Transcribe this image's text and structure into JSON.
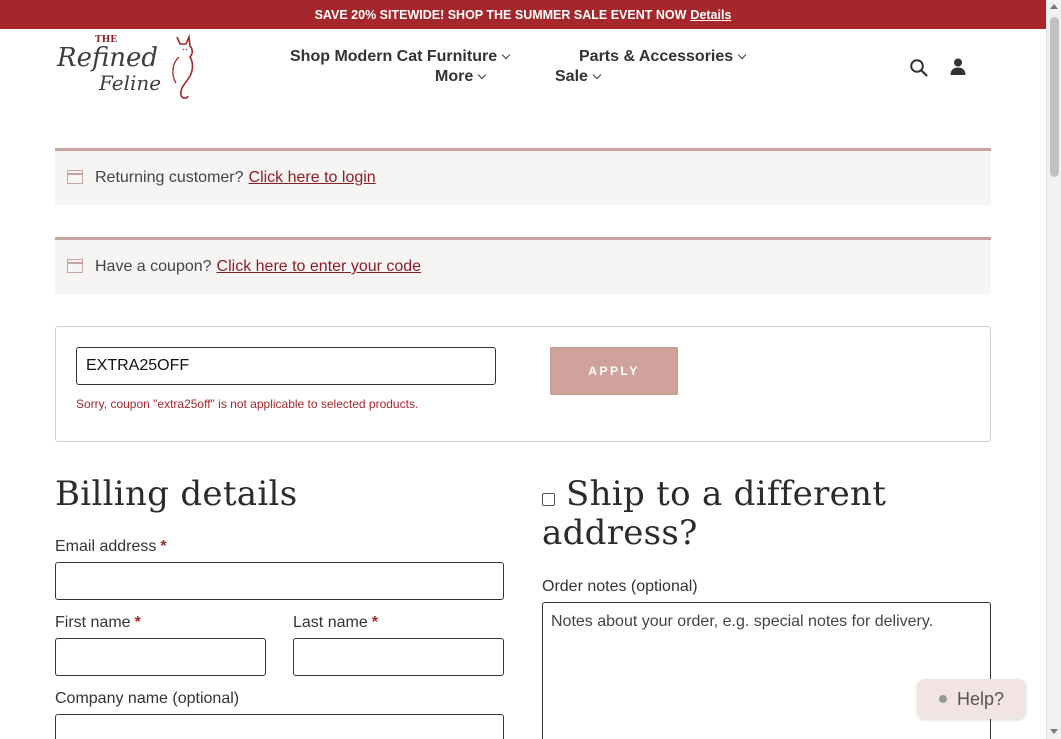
{
  "promo": {
    "text": "SAVE 20% SITEWIDE! SHOP THE SUMMER SALE EVENT NOW",
    "link_label": "Details"
  },
  "logo": {
    "small": "THE",
    "line1": "Refined",
    "line2": "Feline",
    "icon": "cat-silhouette-logo"
  },
  "nav": {
    "items": [
      {
        "label": "Shop Modern Cat Furniture"
      },
      {
        "label": "Parts & Accessories"
      },
      {
        "label": "More"
      },
      {
        "label": "Sale"
      }
    ],
    "icons": [
      "search-icon",
      "account-icon",
      "chevron-down-icon"
    ]
  },
  "notices": {
    "login": {
      "text": "Returning customer?",
      "link_label": "Click here to login"
    },
    "coupon": {
      "text": "Have a coupon?",
      "link_label": "Click here to enter your code"
    }
  },
  "coupon_form": {
    "value": "EXTRA25OFF",
    "error": "Sorry, coupon \"extra25off\" is not applicable to selected products.",
    "apply_label": "APPLY"
  },
  "billing": {
    "title": "Billing details",
    "fields": {
      "email": {
        "label": "Email address",
        "required": "*"
      },
      "first_name": {
        "label": "First name",
        "required": "*"
      },
      "last_name": {
        "label": "Last name",
        "required": "*"
      },
      "company": {
        "label": "Company name (optional)"
      }
    }
  },
  "shipping": {
    "title_line1": "Ship to a different",
    "title_line2": "address?",
    "notes_label": "Order notes (optional)",
    "notes_placeholder": "Notes about your order, e.g. special notes for delivery."
  },
  "help": {
    "label": "Help?"
  },
  "colors": {
    "brand_red": "#a5272b",
    "accent_rose": "#cfa39c",
    "link_red": "#8b1f24"
  }
}
